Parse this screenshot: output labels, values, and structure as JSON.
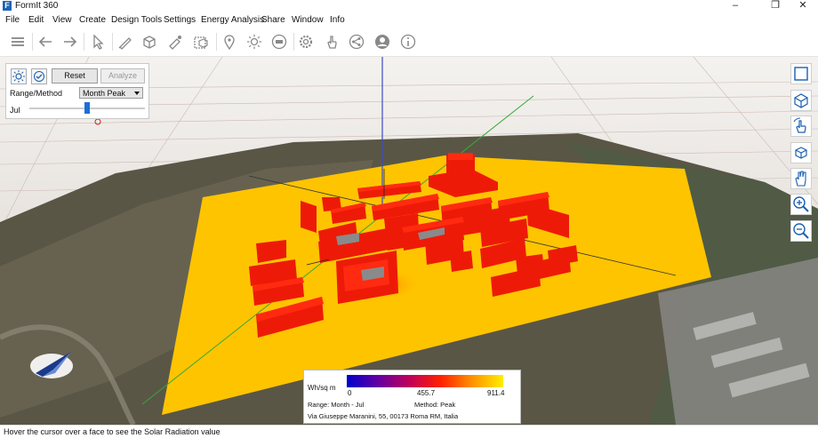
{
  "app": {
    "title": "FormIt 360",
    "icon_letter": "F"
  },
  "window_controls": {
    "minimize": "–",
    "maximize": "❐",
    "close": "✕"
  },
  "menu": [
    "File",
    "Edit",
    "View",
    "Create",
    "Design Tools",
    "Settings",
    "Energy Analysis",
    "Share",
    "Window",
    "Info"
  ],
  "toolbar_icons": [
    "layers-icon",
    "undo-icon",
    "redo-icon",
    "select-icon",
    "sketch-icon",
    "cube-icon",
    "materials-icon",
    "groups-icon",
    "location-icon",
    "sun-icon",
    "orbit-360-icon",
    "settings-icon",
    "gesture-icon",
    "share-icon",
    "account-icon",
    "info-icon"
  ],
  "analysis_panel": {
    "reset_label": "Reset",
    "analyze_label": "Analyze",
    "range_label": "Range/Method",
    "method_value": "Month Peak",
    "month_label": "Jul",
    "slider_fraction": 0.5
  },
  "nav_icons": [
    "zoom-extents-icon",
    "view-cube-icon",
    "orbit-icon",
    "views-icon",
    "pan-icon",
    "zoom-in-icon",
    "zoom-out-icon"
  ],
  "legend": {
    "unit": "Wh/sq m",
    "min": "0",
    "mid": "455.7",
    "max": "911.4",
    "range_text": "Range: Month - Jul",
    "method_text": "Method: Peak",
    "address": "Via Giuseppe Maranini, 55, 00173 Roma RM, Italia",
    "colors": [
      "#0000cc",
      "#5a00a8",
      "#c0005a",
      "#ff2000",
      "#ff9000",
      "#fff000"
    ]
  },
  "status_text": "Hover the cursor over a face to see the Solar Radiation value",
  "colors": {
    "ground_plane": "#ffc400",
    "building": "#ff2a10",
    "building_side": "#ee1a08"
  }
}
